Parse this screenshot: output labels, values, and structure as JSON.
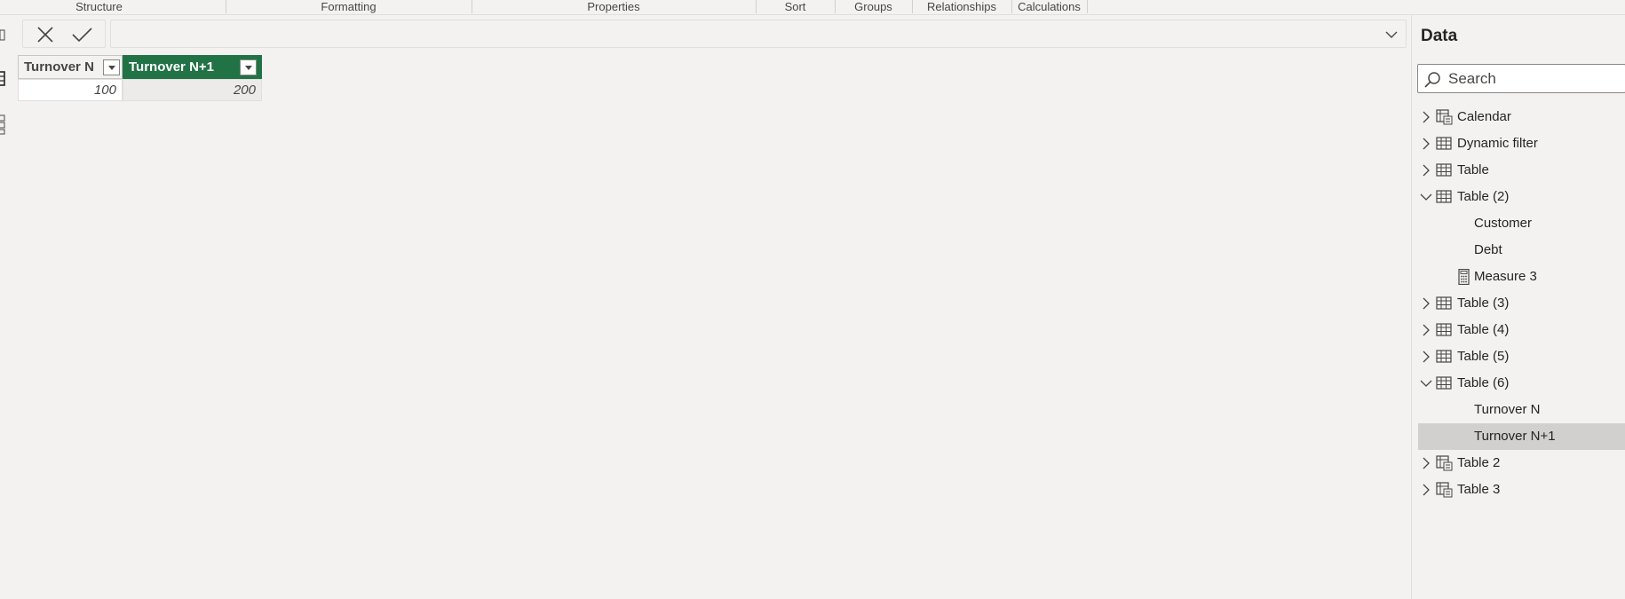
{
  "ribbon": {
    "groups": [
      "Structure",
      "Formatting",
      "Properties",
      "Sort",
      "Groups",
      "Relationships",
      "Calculations"
    ]
  },
  "formula_bar": {
    "cancel_icon": "close-icon",
    "commit_icon": "checkmark-icon",
    "expand_icon": "chevron-down-icon",
    "value": ""
  },
  "table_view": {
    "columns": [
      {
        "header": "Turnover N",
        "selected": false
      },
      {
        "header": "Turnover N+1",
        "selected": true
      }
    ],
    "rows": [
      [
        "100",
        "200"
      ]
    ],
    "accent": "#217346"
  },
  "data_pane": {
    "title": "Data",
    "search_placeholder": "Search",
    "items": [
      {
        "label": "Calendar",
        "icon": "calculated-table-icon",
        "expanded": false
      },
      {
        "label": "Dynamic filter",
        "icon": "table-icon",
        "expanded": false
      },
      {
        "label": "Table",
        "icon": "table-icon",
        "expanded": false
      },
      {
        "label": "Table (2)",
        "icon": "table-icon",
        "expanded": true
      },
      {
        "label": "Customer",
        "icon": "",
        "child": true
      },
      {
        "label": "Debt",
        "icon": "",
        "child": true
      },
      {
        "label": "Measure 3",
        "icon": "calculator-icon",
        "child": true
      },
      {
        "label": "Table (3)",
        "icon": "table-icon",
        "expanded": false
      },
      {
        "label": "Table (4)",
        "icon": "table-icon",
        "expanded": false
      },
      {
        "label": "Table (5)",
        "icon": "table-icon",
        "expanded": false
      },
      {
        "label": "Table (6)",
        "icon": "table-icon",
        "expanded": true
      },
      {
        "label": "Turnover N",
        "icon": "",
        "child": true
      },
      {
        "label": "Turnover N+1",
        "icon": "",
        "child": true,
        "selected": true
      },
      {
        "label": "Table 2",
        "icon": "calculated-table-icon",
        "expanded": false
      },
      {
        "label": "Table 3",
        "icon": "calculated-table-icon",
        "expanded": false
      }
    ]
  }
}
